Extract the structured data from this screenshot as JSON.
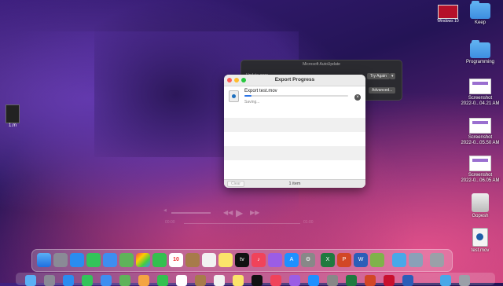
{
  "desktop": {
    "right_icons": [
      {
        "label": "Keep",
        "kind": "folder"
      },
      {
        "label": "Programming",
        "kind": "folder"
      },
      {
        "label": "Screenshot\n2022-0...04.21 AM",
        "kind": "thumb"
      },
      {
        "label": "Screenshot\n2022-0...05.50 AM",
        "kind": "thumb"
      },
      {
        "label": "Screenshot\n2022-0...06.05 AM",
        "kind": "thumb"
      },
      {
        "label": "Gopesh",
        "kind": "drive"
      },
      {
        "label": "test.mov",
        "kind": "file"
      }
    ],
    "windows10_label": "Windows 10",
    "left_file_label": "1.m"
  },
  "autoupdate": {
    "title": "Microsoft AutoUpdate",
    "subtitle": "Update error",
    "try_again": "Try Again",
    "advanced": "Advanced..."
  },
  "export": {
    "title": "Export Progress",
    "file_name": "Export test.mov",
    "status": "Saving...",
    "progress": 0.07,
    "items_label": "1 item",
    "clear_label": "Clear"
  },
  "player": {
    "time_start": "00:00",
    "time_end": "01:00"
  },
  "dock": {
    "calendar_day": "10"
  }
}
